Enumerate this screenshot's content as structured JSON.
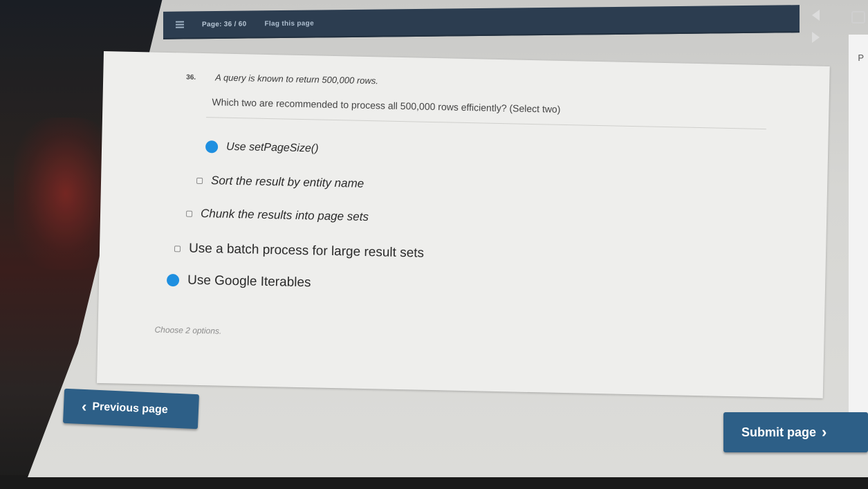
{
  "topbar": {
    "page_indicator": "Page: 36 / 60",
    "flag_label": "Flag this page",
    "menu_icon": "hamburger-icon"
  },
  "right_panel": {
    "letter": "P"
  },
  "question": {
    "number": "36.",
    "text": "A query is known to return 500,000 rows.",
    "prompt": "Which two are recommended to process all 500,000 rows efficiently? (Select two)",
    "options": [
      {
        "label": "Use setPageSize()",
        "selected": true
      },
      {
        "label": "Sort the result by entity name",
        "selected": false
      },
      {
        "label": "Chunk the results into page sets",
        "selected": false
      },
      {
        "label": "Use a batch process for large result sets",
        "selected": false
      },
      {
        "label": "Use Google Iterables",
        "selected": true
      }
    ],
    "hint": "Choose 2 options."
  },
  "navigation": {
    "previous_label": "Previous page",
    "previous_icon": "chevron-left-icon",
    "submit_label": "Submit page",
    "submit_icon": "chevron-right-icon"
  },
  "colors": {
    "topbar": "#2c3d50",
    "button": "#2d5f87",
    "selected_mark": "#1e8fe0",
    "card": "#eeeeec"
  }
}
